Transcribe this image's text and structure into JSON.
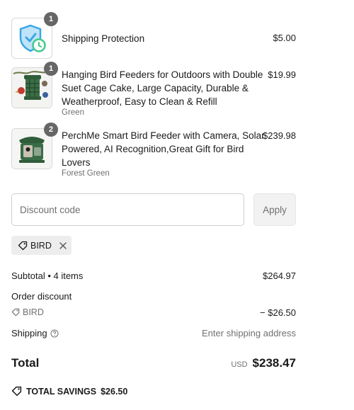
{
  "items": [
    {
      "title": "Shipping Protection",
      "variant": "",
      "price": "$5.00",
      "quantity": "1",
      "icon": "shield-clock-icon"
    },
    {
      "title": "Hanging Bird Feeders for Outdoors with Double Suet Cage Cake, Large Capacity, Durable & Weatherproof, Easy to Clean & Refill",
      "variant": "Green",
      "price": "$19.99",
      "quantity": "1",
      "icon": "bird-feeder-image"
    },
    {
      "title": "PerchMe Smart Bird Feeder with Camera, Solar Powered, AI Recognition,Great Gift for Bird Lovers",
      "variant": "Forest Green",
      "price": "$239.98",
      "quantity": "2",
      "icon": "smart-feeder-image"
    }
  ],
  "discount": {
    "placeholder": "Discount code",
    "apply_label": "Apply",
    "applied_code": "BIRD"
  },
  "summary": {
    "subtotal_label": "Subtotal • 4 items",
    "subtotal_value": "$264.97",
    "order_discount_label": "Order discount",
    "discount_code": "BIRD",
    "discount_value": "− $26.50",
    "shipping_label": "Shipping",
    "shipping_value": "Enter shipping address",
    "total_label": "Total",
    "currency": "USD",
    "total_value": "$238.47",
    "savings_label": "TOTAL SAVINGS",
    "savings_value": "$26.50"
  },
  "colors": {
    "badge": "#666666",
    "muted_text": "#707070",
    "shield_blue": "#3aa6e6",
    "clock_green": "#3fc98a",
    "feeder_green": "#2f5d3a"
  }
}
